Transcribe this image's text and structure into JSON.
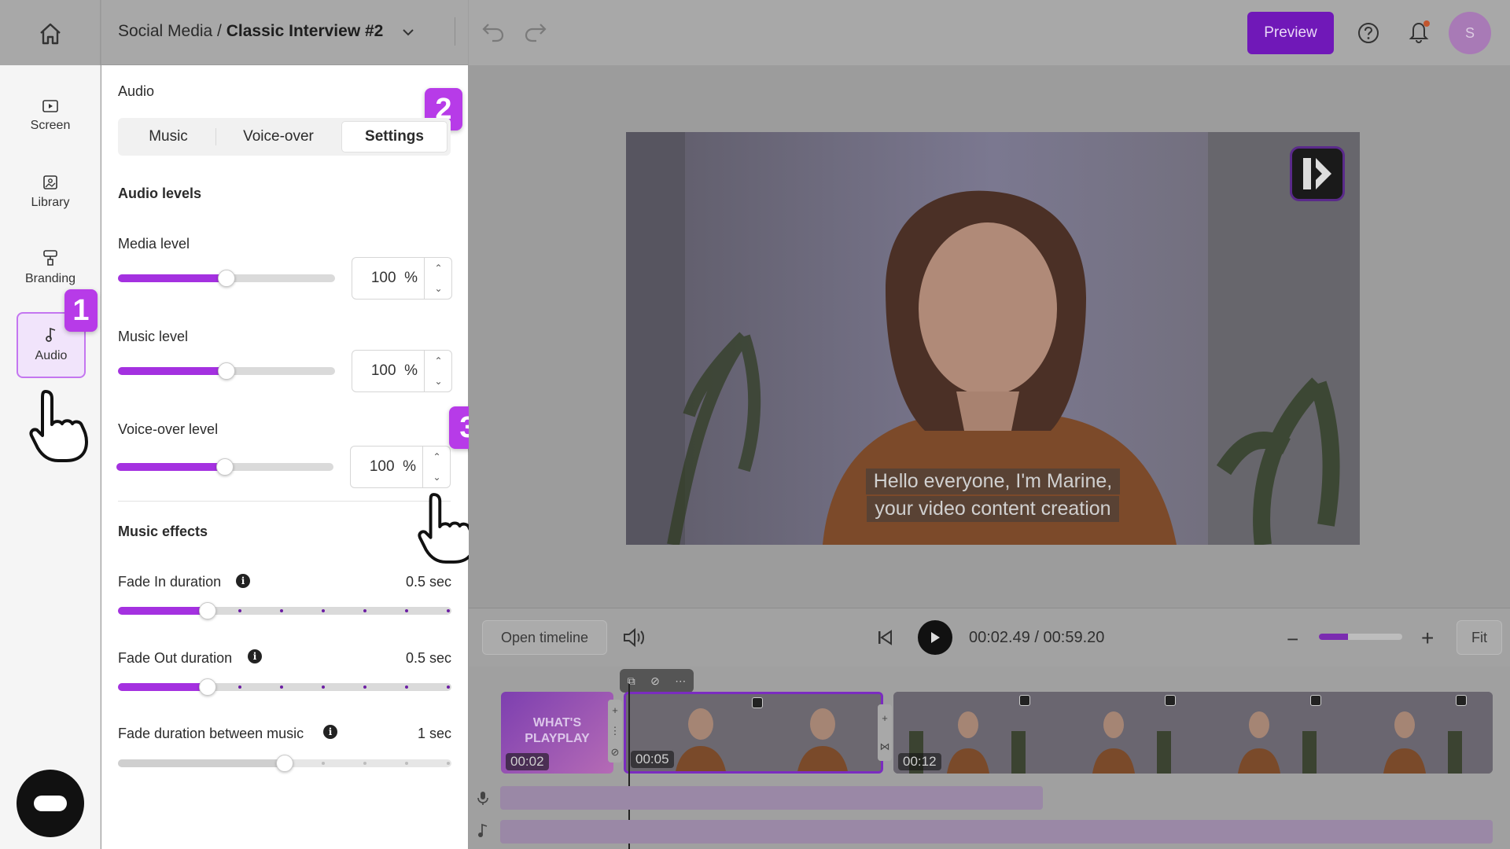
{
  "header": {
    "breadcrumb_parent": "Social Media / ",
    "breadcrumb_current": "Classic Interview #2",
    "preview_label": "Preview",
    "avatar_initial": "S"
  },
  "rail": {
    "items": [
      {
        "label": "Screen",
        "icon": "screen-icon"
      },
      {
        "label": "Library",
        "icon": "image-icon"
      },
      {
        "label": "Branding",
        "icon": "paint-roller-icon"
      },
      {
        "label": "Audio",
        "icon": "music-note-icon",
        "active": true
      }
    ]
  },
  "steps": {
    "one": "1",
    "two": "2",
    "three": "3"
  },
  "panel": {
    "title": "Audio",
    "tabs": [
      "Music",
      "Voice-over",
      "Settings"
    ],
    "active_tab": "Settings",
    "levels_heading": "Audio levels",
    "levels": [
      {
        "label": "Media level",
        "value": "100",
        "unit": "%",
        "fraction": 0.5
      },
      {
        "label": "Music level",
        "value": "100",
        "unit": "%",
        "fraction": 0.5
      },
      {
        "label": "Voice-over level",
        "value": "100",
        "unit": "%",
        "fraction": 0.5
      }
    ],
    "effects_heading": "Music effects",
    "effects": [
      {
        "label": "Fade In duration",
        "value": "0.5 sec",
        "fraction": 0.27
      },
      {
        "label": "Fade Out duration",
        "value": "0.5 sec",
        "fraction": 0.27
      },
      {
        "label": "Fade duration between music",
        "value": "1 sec",
        "fraction": 0.5
      }
    ]
  },
  "video": {
    "caption_line1": "Hello everyone, I'm Marine,",
    "caption_line2": "your video content creation"
  },
  "controls": {
    "open_timeline": "Open timeline",
    "time": "00:02.49 / 00:59.20",
    "fit": "Fit",
    "zoom_fraction": 0.35
  },
  "timeline": {
    "clip1_time": "00:02",
    "clip1_text": "WHAT'S PLAYPLAY",
    "clip2_time": "00:05",
    "clip3_time": "00:12"
  },
  "colors": {
    "accent": "#a431e0",
    "badge": "#b73be8",
    "preview_button": "#7018b8"
  }
}
